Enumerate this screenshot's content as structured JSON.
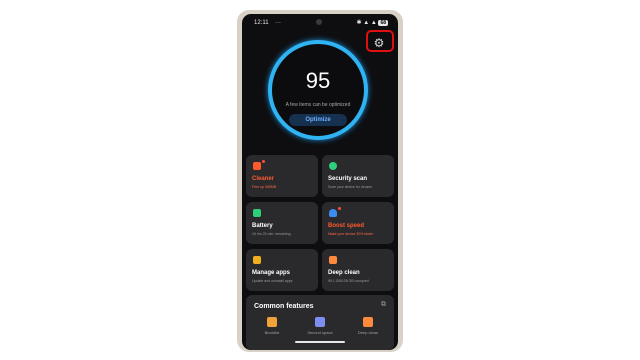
{
  "status_bar": {
    "time": "12:11",
    "dots": "···",
    "icons": "✱ ▲ ▲",
    "battery": "68"
  },
  "settings": {
    "icon": "⚙"
  },
  "score": {
    "value": "95",
    "caption": "A few items can be optimized",
    "button": "Optimize"
  },
  "cards": [
    {
      "title": "Cleaner",
      "subtitle": "Free up 965MB"
    },
    {
      "title": "Security scan",
      "subtitle": "Scan your device for viruses"
    },
    {
      "title": "Battery",
      "subtitle": "16 hrs 29 min. remaining"
    },
    {
      "title": "Boost speed",
      "subtitle": "Make your device 30% faster"
    },
    {
      "title": "Manage apps",
      "subtitle": "Update and uninstall apps"
    },
    {
      "title": "Deep clean",
      "subtitle": "95.1 GB/128 GB occupied"
    }
  ],
  "common_features": {
    "title": "Common features",
    "edit_icon": "⧉",
    "items": [
      {
        "label": "Blocklist"
      },
      {
        "label": "Second space"
      },
      {
        "label": "Deep clean"
      }
    ]
  },
  "colors": {
    "ring": "#2fb3f3",
    "alert": "#ff5a2e",
    "highlight": "#e01010"
  }
}
